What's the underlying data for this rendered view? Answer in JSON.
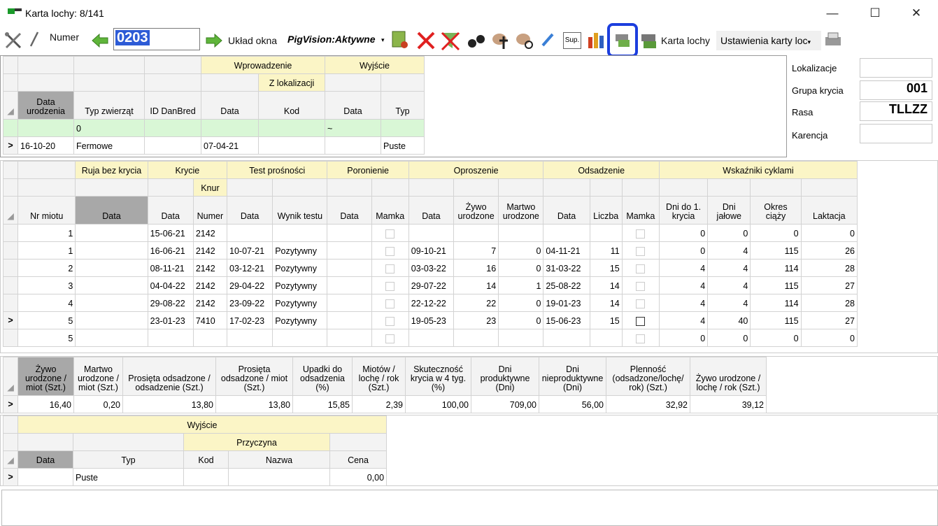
{
  "window": {
    "title": "Karta lochy: 8/141",
    "minimize": "—",
    "maximize": "☐",
    "close": "✕"
  },
  "toolbar": {
    "numer_label": "Numer",
    "numer_value": "0203",
    "uklad_label": "Układ okna",
    "pigvision_label": "PigVision:Aktywne",
    "sup_label": "Sup.",
    "karta_label": "Karta lochy",
    "ustawienia_label": "Ustawienia karty loc"
  },
  "side_panel": {
    "lokalizacje_label": "Lokalizacje",
    "lokalizacje_value": "",
    "grupa_label": "Grupa krycia",
    "grupa_value": "001",
    "rasa_label": "Rasa",
    "rasa_value": "TLLZZ",
    "karencja_label": "Karencja",
    "karencja_value": ""
  },
  "grid1": {
    "group_wprowadzenie": "Wprowadzenie",
    "group_wyjscie": "Wyjście",
    "sub_zlok": "Z lokalizacji",
    "headers": [
      "Data urodzenia",
      "Typ zwierząt",
      "ID DanBred",
      "Data",
      "Kod",
      "Data",
      "Typ"
    ],
    "filter_typ": "0",
    "filter_data": "~",
    "row": {
      "marker": ">",
      "data_ur": "16-10-20",
      "typ": "Fermowe",
      "id": "",
      "w_data": "07-04-21",
      "kod": "",
      "wy_data": "",
      "wy_typ": "Puste"
    }
  },
  "grid2": {
    "groups": {
      "ruja": "Ruja bez krycia",
      "krycie": "Krycie",
      "test": "Test prośności",
      "poronienie": "Poronienie",
      "oproszenie": "Oproszenie",
      "odsadzenie": "Odsadzenie",
      "wskazniki": "Wskaźniki cyklami"
    },
    "sub_knur": "Knur",
    "headers": [
      "Nr miotu",
      "Data",
      "Data",
      "Numer",
      "Data",
      "Wynik testu",
      "Data",
      "Mamka",
      "Data",
      "Żywo urodzone",
      "Martwo urodzone",
      "Data",
      "Liczba",
      "Mamka",
      "Dni do 1. krycia",
      "Dni jałowe",
      "Okres ciąży",
      "Laktacja"
    ],
    "rows": [
      {
        "m": "",
        "nr": "1",
        "ruja": "",
        "kd": "15-06-21",
        "kn": "2142",
        "td": "",
        "tw": "",
        "pd": "",
        "op": "",
        "zu": "",
        "mu": "",
        "od": "",
        "ol": "",
        "d1": "0",
        "dj": "0",
        "oc": "0",
        "lk": "0",
        "cb": "light"
      },
      {
        "m": "",
        "nr": "1",
        "ruja": "",
        "kd": "16-06-21",
        "kn": "2142",
        "td": "10-07-21",
        "tw": "Pozytywny",
        "pd": "",
        "op": "09-10-21",
        "zu": "7",
        "mu": "0",
        "od": "04-11-21",
        "ol": "11",
        "d1": "0",
        "dj": "4",
        "oc": "115",
        "lk": "26",
        "cb": "light"
      },
      {
        "m": "",
        "nr": "2",
        "ruja": "",
        "kd": "08-11-21",
        "kn": "2142",
        "td": "03-12-21",
        "tw": "Pozytywny",
        "pd": "",
        "op": "03-03-22",
        "zu": "16",
        "mu": "0",
        "od": "31-03-22",
        "ol": "15",
        "d1": "4",
        "dj": "4",
        "oc": "114",
        "lk": "28",
        "cb": "light"
      },
      {
        "m": "",
        "nr": "3",
        "ruja": "",
        "kd": "04-04-22",
        "kn": "2142",
        "td": "29-04-22",
        "tw": "Pozytywny",
        "pd": "",
        "op": "29-07-22",
        "zu": "14",
        "mu": "1",
        "od": "25-08-22",
        "ol": "14",
        "d1": "4",
        "dj": "4",
        "oc": "115",
        "lk": "27",
        "cb": "light"
      },
      {
        "m": "",
        "nr": "4",
        "ruja": "",
        "kd": "29-08-22",
        "kn": "2142",
        "td": "23-09-22",
        "tw": "Pozytywny",
        "pd": "",
        "op": "22-12-22",
        "zu": "22",
        "mu": "0",
        "od": "19-01-23",
        "ol": "14",
        "d1": "4",
        "dj": "4",
        "oc": "114",
        "lk": "28",
        "cb": "light"
      },
      {
        "m": ">",
        "nr": "5",
        "ruja": "",
        "kd": "23-01-23",
        "kn": "7410",
        "td": "17-02-23",
        "tw": "Pozytywny",
        "pd": "",
        "op": "19-05-23",
        "zu": "23",
        "mu": "0",
        "od": "15-06-23",
        "ol": "15",
        "d1": "4",
        "dj": "40",
        "oc": "115",
        "lk": "27",
        "cb": "dark"
      },
      {
        "m": "",
        "nr": "5",
        "ruja": "",
        "kd": "",
        "kn": "",
        "td": "",
        "tw": "",
        "pd": "",
        "op": "",
        "zu": "",
        "mu": "",
        "od": "",
        "ol": "",
        "d1": "0",
        "dj": "0",
        "oc": "0",
        "lk": "0",
        "cb": "light"
      }
    ]
  },
  "grid3": {
    "headers": [
      "Żywo urodzone / miot (Szt.)",
      "Martwo urodzone / miot (Szt.)",
      "Prosięta odsadzone / odsadzenie (Szt.)",
      "Prosięta odsadzone / miot (Szt.)",
      "Upadki do odsadzenia (%)",
      "Miotów / lochę / rok (Szt.)",
      "Skuteczność krycia w 4 tyg. (%)",
      "Dni produktywne (Dni)",
      "Dni nieproduktywne (Dni)",
      "Plenność (odsadzone/lochę/ rok) (Szt.)",
      "Żywo urodzone / lochę / rok (Szt.)"
    ],
    "marker": ">",
    "values": [
      "16,40",
      "0,20",
      "13,80",
      "13,80",
      "15,85",
      "2,39",
      "100,00",
      "709,00",
      "56,00",
      "32,92",
      "39,12"
    ]
  },
  "grid4": {
    "group_wyjscie": "Wyjście",
    "sub_przyczyna": "Przyczyna",
    "headers": [
      "Data",
      "Typ",
      "Kod",
      "Nazwa",
      "Cena"
    ],
    "row": {
      "marker": ">",
      "data": "",
      "typ": "Puste",
      "kod": "",
      "nazwa": "",
      "cena": "0,00"
    }
  }
}
